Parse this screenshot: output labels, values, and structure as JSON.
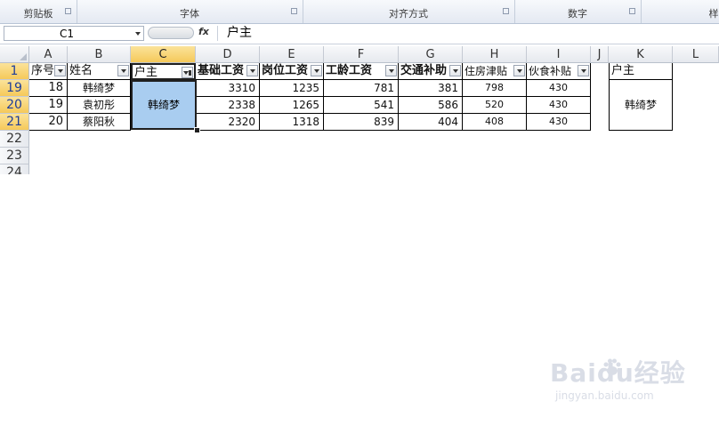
{
  "ribbon": {
    "groups": [
      {
        "label": "剪贴板"
      },
      {
        "label": "字体"
      },
      {
        "label": "对齐方式"
      },
      {
        "label": "数字"
      },
      {
        "label": "样"
      }
    ]
  },
  "formula_bar": {
    "name_box": "C1",
    "fx_label": "fx",
    "content": "户主"
  },
  "columns": [
    "A",
    "B",
    "C",
    "D",
    "E",
    "F",
    "G",
    "H",
    "I",
    "J",
    "K",
    "L"
  ],
  "selected_column": "C",
  "rows": {
    "header_row": "1",
    "data_rows": [
      "19",
      "20",
      "21"
    ],
    "empty_rows": [
      "22",
      "23",
      "24"
    ]
  },
  "table": {
    "headers": [
      "序号",
      "姓名",
      "户主",
      "基础工资",
      "岗位工资",
      "工龄工资",
      "交通补助",
      "住房津贴",
      "伙食补贴"
    ],
    "rows": [
      {
        "seq": "18",
        "name": "韩绮梦",
        "base": "3310",
        "post": "1235",
        "seniority": "781",
        "transport": "381",
        "housing": "798",
        "meal": "430"
      },
      {
        "seq": "19",
        "name": "袁初彤",
        "base": "2338",
        "post": "1265",
        "seniority": "541",
        "transport": "586",
        "housing": "520",
        "meal": "430"
      },
      {
        "seq": "20",
        "name": "蔡阳秋",
        "base": "2320",
        "post": "1318",
        "seniority": "839",
        "transport": "404",
        "housing": "408",
        "meal": "430"
      }
    ],
    "merged_householder": "韩绮梦"
  },
  "side_table": {
    "header": "户主",
    "value": "韩绮梦"
  },
  "watermark": {
    "brand": "Baidu经验",
    "url": "jingyan.baidu.com"
  },
  "colors": {
    "selected_fill": "#a9cdf0",
    "header_highlight": "#f5c95a",
    "row_number_blue": "#1e3d9a"
  }
}
